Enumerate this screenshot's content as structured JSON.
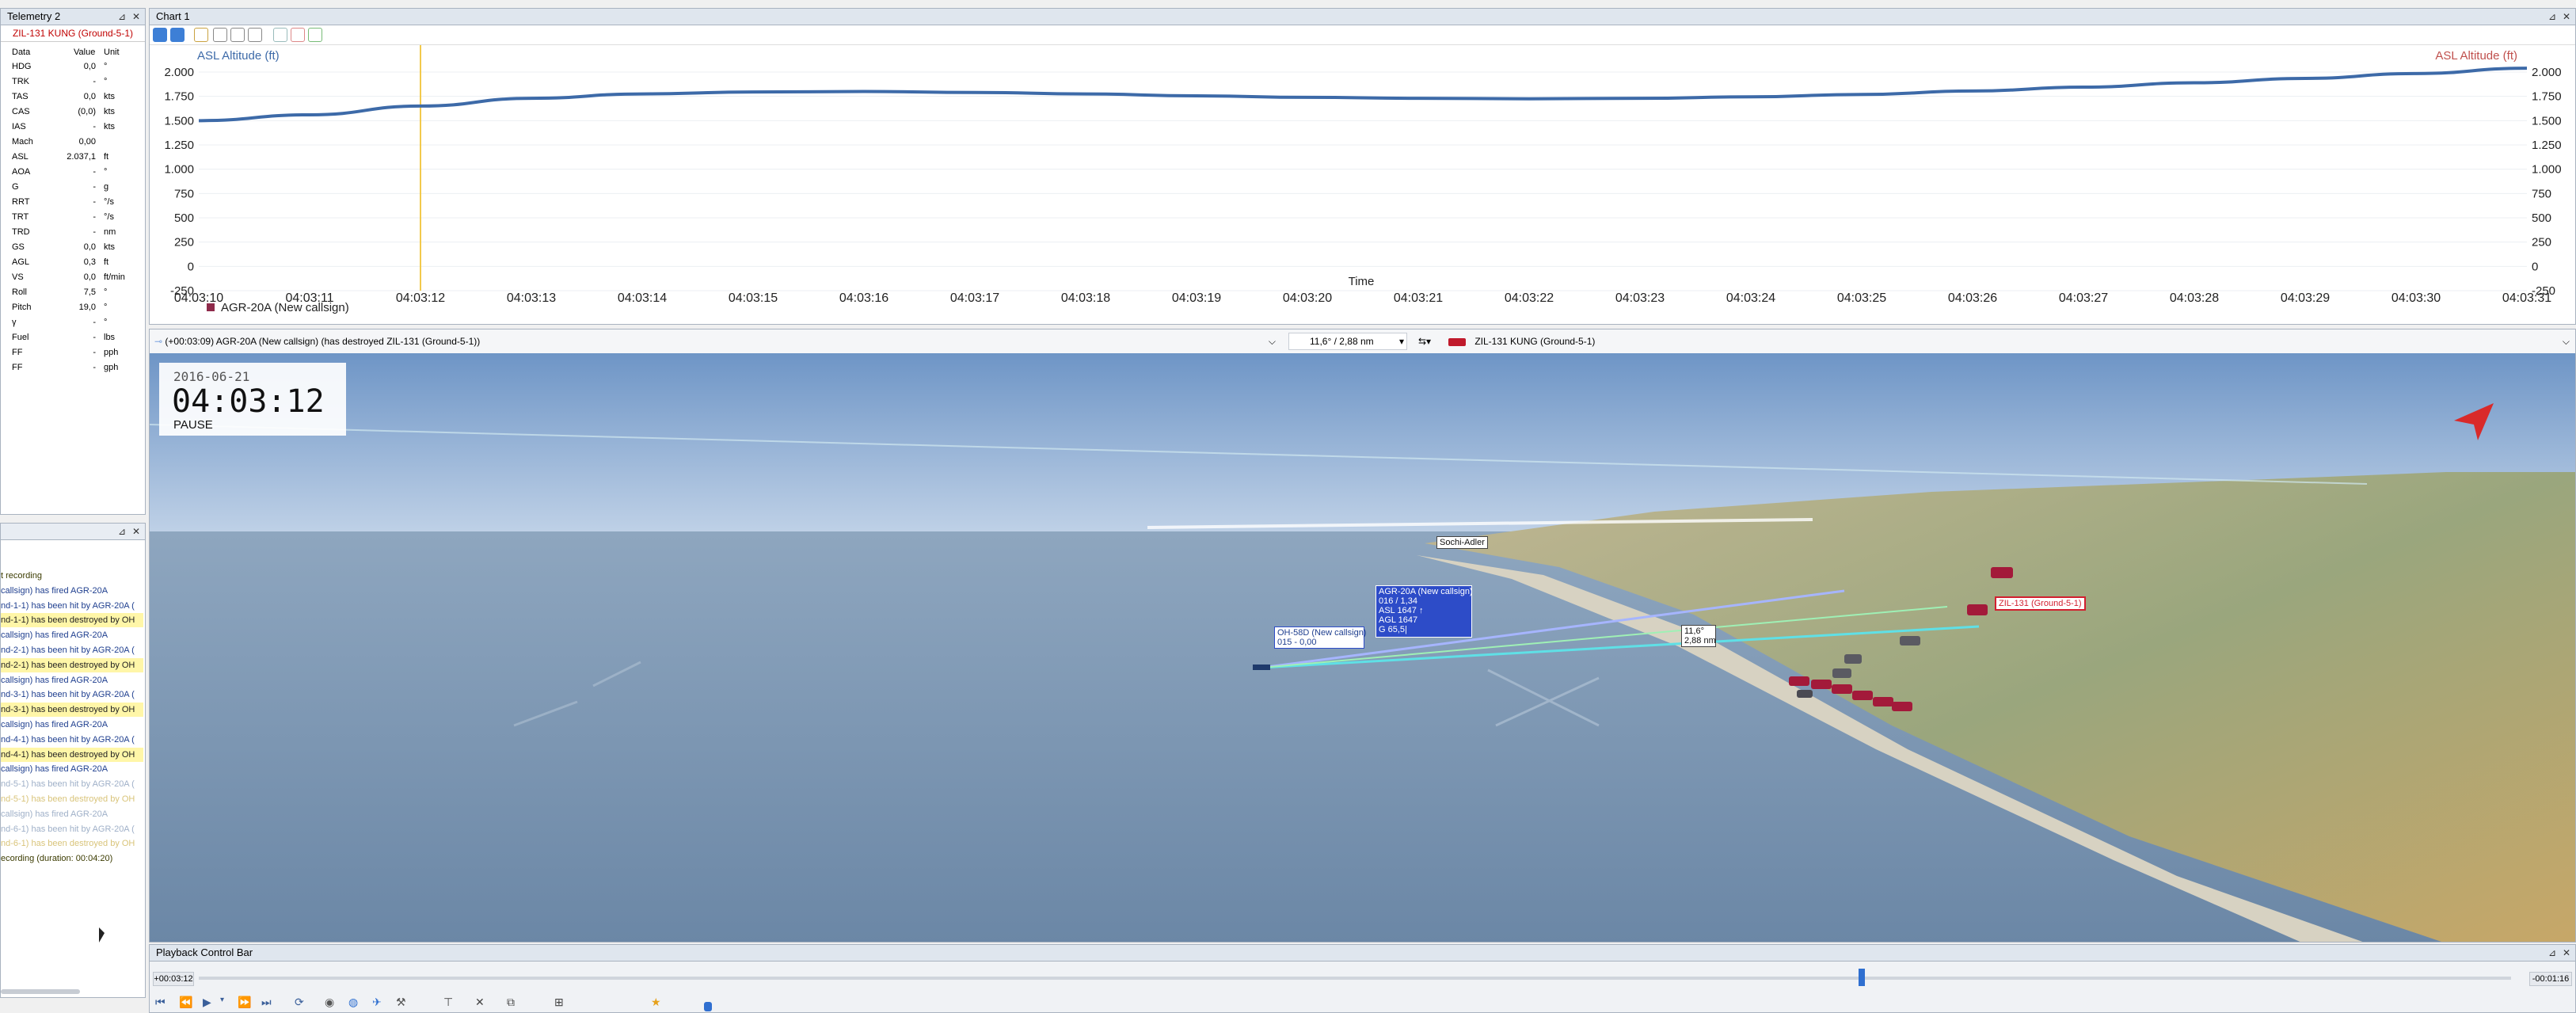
{
  "telemetry": {
    "title": "Telemetry 2",
    "object": "ZIL-131 KUNG (Ground-5-1)",
    "headers": [
      "Data",
      "Value",
      "Unit"
    ],
    "rows": [
      {
        "name": "HDG",
        "value": "0,0",
        "unit": "°"
      },
      {
        "name": "TRK",
        "value": "-",
        "unit": "°"
      },
      {
        "name": "TAS",
        "value": "0,0",
        "unit": "kts"
      },
      {
        "name": "CAS",
        "value": "(0,0)",
        "unit": "kts"
      },
      {
        "name": "IAS",
        "value": "-",
        "unit": "kts"
      },
      {
        "name": "Mach",
        "value": "0,00",
        "unit": ""
      },
      {
        "name": "ASL",
        "value": "2.037,1",
        "unit": "ft"
      },
      {
        "name": "AOA",
        "value": "-",
        "unit": "°"
      },
      {
        "name": "G",
        "value": "-",
        "unit": "g"
      },
      {
        "name": "RRT",
        "value": "-",
        "unit": "°/s"
      },
      {
        "name": "TRT",
        "value": "-",
        "unit": "°/s"
      },
      {
        "name": "TRD",
        "value": "-",
        "unit": "nm"
      },
      {
        "name": "GS",
        "value": "0,0",
        "unit": "kts"
      },
      {
        "name": "AGL",
        "value": "0,3",
        "unit": "ft"
      },
      {
        "name": "VS",
        "value": "0,0",
        "unit": "ft/min"
      },
      {
        "name": "Roll",
        "value": "7,5",
        "unit": "°"
      },
      {
        "name": "Pitch",
        "value": "19,0",
        "unit": "°"
      },
      {
        "name": "γ",
        "value": "-",
        "unit": "°"
      },
      {
        "name": "Fuel",
        "value": "-",
        "unit": "lbs"
      },
      {
        "name": "FF",
        "value": "-",
        "unit": "pph"
      },
      {
        "name": "FF",
        "value": "-",
        "unit": "gph"
      }
    ]
  },
  "events": {
    "items": [
      {
        "text": "t recording",
        "style": "olive"
      },
      {
        "text": "callsign) has fired AGR-20A",
        "style": "blue"
      },
      {
        "text": "nd-1-1) has been hit by AGR-20A (",
        "style": "blue"
      },
      {
        "text": "nd-1-1) has been destroyed by OH",
        "style": "yellow"
      },
      {
        "text": "callsign) has fired AGR-20A",
        "style": "blue"
      },
      {
        "text": "nd-2-1) has been hit by AGR-20A (",
        "style": "blue"
      },
      {
        "text": "nd-2-1) has been destroyed by OH",
        "style": "yellow"
      },
      {
        "text": "callsign) has fired AGR-20A",
        "style": "blue"
      },
      {
        "text": "nd-3-1) has been hit by AGR-20A (",
        "style": "blue"
      },
      {
        "text": "nd-3-1) has been destroyed by OH",
        "style": "yellow"
      },
      {
        "text": "callsign) has fired AGR-20A",
        "style": "blue"
      },
      {
        "text": "nd-4-1) has been hit by AGR-20A (",
        "style": "blue"
      },
      {
        "text": "nd-4-1) has been destroyed by OH",
        "style": "yellow"
      },
      {
        "text": "callsign) has fired AGR-20A",
        "style": "blue"
      },
      {
        "text": "nd-5-1) has been hit by AGR-20A (",
        "style": "faint"
      },
      {
        "text": "nd-5-1) has been destroyed by OH",
        "style": "faint-y"
      },
      {
        "text": "callsign) has fired AGR-20A",
        "style": "faint"
      },
      {
        "text": "nd-6-1) has been hit by AGR-20A (",
        "style": "faint"
      },
      {
        "text": "nd-6-1) has been destroyed by OH",
        "style": "faint-y"
      },
      {
        "text": "ecording (duration: 00:04:20)",
        "style": "olive"
      }
    ]
  },
  "chart": {
    "title": "Chart 1",
    "legend_label": "AGR-20A (New callsign)",
    "series_color": "#3d6aa8",
    "cursor_time": "04:03:12",
    "cursor_color": "#f2c94c"
  },
  "chart_data": {
    "type": "line",
    "title": "",
    "xlabel": "Time",
    "ylabel_left": "ASL Altitude (ft)",
    "ylabel_right": "ASL Altitude (ft)",
    "x_ticks": [
      "04:03:10",
      "04:03:11",
      "04:03:12",
      "04:03:13",
      "04:03:14",
      "04:03:15",
      "04:03:16",
      "04:03:17",
      "04:03:18",
      "04:03:19",
      "04:03:20",
      "04:03:21",
      "04:03:22",
      "04:03:23",
      "04:03:24",
      "04:03:25",
      "04:03:26",
      "04:03:27",
      "04:03:28",
      "04:03:29",
      "04:03:30",
      "04:03:31"
    ],
    "y_ticks": [
      "2.000",
      "1.750",
      "1.500",
      "1.250",
      "1.000",
      "750",
      "500",
      "250",
      "0",
      "-250"
    ],
    "ylim": [
      -250,
      2000
    ],
    "series": [
      {
        "name": "AGR-20A (New callsign)",
        "x": [
          "04:03:10",
          "04:03:11",
          "04:03:12",
          "04:03:13",
          "04:03:14",
          "04:03:15",
          "04:03:16",
          "04:03:17",
          "04:03:18",
          "04:03:19",
          "04:03:20",
          "04:03:21",
          "04:03:22",
          "04:03:23",
          "04:03:24",
          "04:03:25",
          "04:03:26",
          "04:03:27",
          "04:03:28",
          "04:03:29",
          "04:03:30",
          "04:03:31"
        ],
        "values": [
          1500,
          1560,
          1650,
          1730,
          1775,
          1795,
          1800,
          1790,
          1775,
          1755,
          1740,
          1730,
          1725,
          1730,
          1745,
          1770,
          1805,
          1845,
          1890,
          1935,
          1985,
          2040
        ]
      }
    ]
  },
  "view3d": {
    "event_line": "(+00:03:09) AGR-20A (New callsign) (has destroyed ZIL-131 (Ground-5-1))",
    "range_text": "11,6° / 2,88 nm",
    "target_text": "ZIL-131 KUNG (Ground-5-1)",
    "date": "2016-06-21",
    "time": "04:03:12",
    "state": "PAUSE",
    "label_sochi": "Sochi-Adler",
    "label_agr": [
      "AGR-20A (New callsign)",
      "016 / 1,34",
      "ASL 1647 ↑",
      "AGL 1647",
      "G 65,5|"
    ],
    "label_oh": [
      "OH-58D (New callsign)",
      "015 - 0,00"
    ],
    "label_zil": "ZIL-131 (Ground-5-1)",
    "label_range": [
      "11,6°",
      "2,88 nm"
    ]
  },
  "playback": {
    "title": "Playback Control Bar",
    "elapsed": "+00:03:12",
    "remaining": "-00:01:16"
  }
}
